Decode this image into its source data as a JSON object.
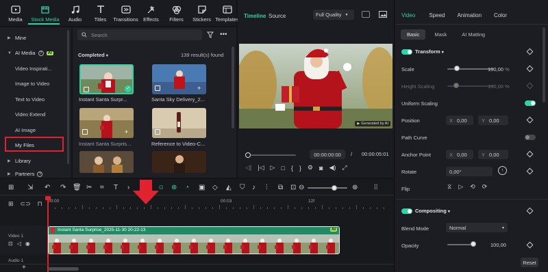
{
  "toolbar": {
    "items": [
      {
        "label": "Media",
        "icon": "media-icon"
      },
      {
        "label": "Stock Media",
        "icon": "stock-media-icon",
        "active": true
      },
      {
        "label": "Audio",
        "icon": "audio-icon"
      },
      {
        "label": "Titles",
        "icon": "titles-icon"
      },
      {
        "label": "Transitions",
        "icon": "transitions-icon"
      },
      {
        "label": "Effects",
        "icon": "effects-icon"
      },
      {
        "label": "Filters",
        "icon": "filters-icon"
      },
      {
        "label": "Stickers",
        "icon": "stickers-icon"
      },
      {
        "label": "Templates",
        "icon": "templates-icon"
      }
    ]
  },
  "sidebar": {
    "mine": "Mine",
    "ai_media": "AI Media",
    "ai_badge": "AI",
    "items": [
      "Video Inspirati...",
      "Image to Video",
      "Text to Video",
      "Video Extend",
      "AI Image",
      "My Files"
    ],
    "library": "Library",
    "partners": "Partners"
  },
  "media": {
    "search_placeholder": "Search",
    "sort_label": "Completed",
    "result_count": "139 result(s) found",
    "thumbs": [
      {
        "label": "Instant Santa Surpr...",
        "time": ""
      },
      {
        "label": "Santa Sky Delivery_2...",
        "time": ""
      },
      {
        "label": "Instant Santa Surpris...",
        "time": ""
      },
      {
        "label": "Reference to Video-C...",
        "time": ""
      }
    ]
  },
  "preview": {
    "tab_timeline": "Timeline",
    "tab_source": "Source",
    "quality": "Full Quality",
    "watermark": "Generated by AI",
    "current_time": "00:00:00:00",
    "separator": "/",
    "total_time": "00:00:05:01"
  },
  "timeline": {
    "ruler": [
      "00:00",
      "00:03",
      "12f"
    ],
    "clip_title": "Instant Santa Surprise_2025-11-30 20-22-13",
    "clip_badge": "AI",
    "track_video": "Video 1",
    "track_audio": "Audio 1"
  },
  "props": {
    "tabs": [
      "Video",
      "Speed",
      "Animation",
      "Color"
    ],
    "subtabs": [
      "Basic",
      "Mask",
      "AI Matting"
    ],
    "transform": "Transform",
    "scale_label": "Scale",
    "scale_value": "100,00",
    "scale_unit": "%",
    "height_label": "Height Scaling",
    "height_value": "100,00",
    "height_unit": "%",
    "uniform_label": "Uniform Scaling",
    "position_label": "Position",
    "pos_x_label": "X",
    "pos_x": "0,00",
    "pos_y_label": "Y",
    "pos_y": "0,00",
    "path_curve": "Path Curve",
    "anchor_label": "Anchor Point",
    "anchor_x": "0,00",
    "anchor_y": "0,00",
    "rotate_label": "Rotate",
    "rotate_value": "0,00°",
    "flip_label": "Flip",
    "compositing": "Compositing",
    "blend_label": "Blend Mode",
    "blend_value": "Normal",
    "opacity_label": "Opacity",
    "opacity_value": "100,00",
    "reset": "Reset",
    "scale_level": 0.2,
    "opacity_level": 1.0
  },
  "colors": {
    "accent": "#2ed3a6",
    "highlight": "#e0232f",
    "clip": "#2aa87e"
  }
}
